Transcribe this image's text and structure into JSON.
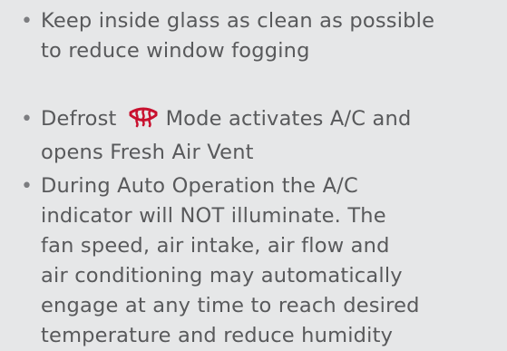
{
  "bullets": [
    {
      "lines": [
        "Keep inside glass as clean as possible",
        "to reduce window fogging"
      ]
    },
    {
      "before_icon": "Defrost",
      "icon": "front-defrost-icon",
      "after_icon": "Mode activates A/C and",
      "continuation": "opens Fresh Air Vent"
    },
    {
      "lines": [
        "During Auto Operation the A/C",
        "indicator will NOT illuminate. The",
        "fan speed, air intake, air flow and",
        "air conditioning may automatically",
        "engage at any time to reach desired",
        "temperature and reduce humidity"
      ]
    }
  ],
  "colors": {
    "background": "#e6e7e8",
    "text": "#58595b",
    "icon": "#c8102e"
  }
}
